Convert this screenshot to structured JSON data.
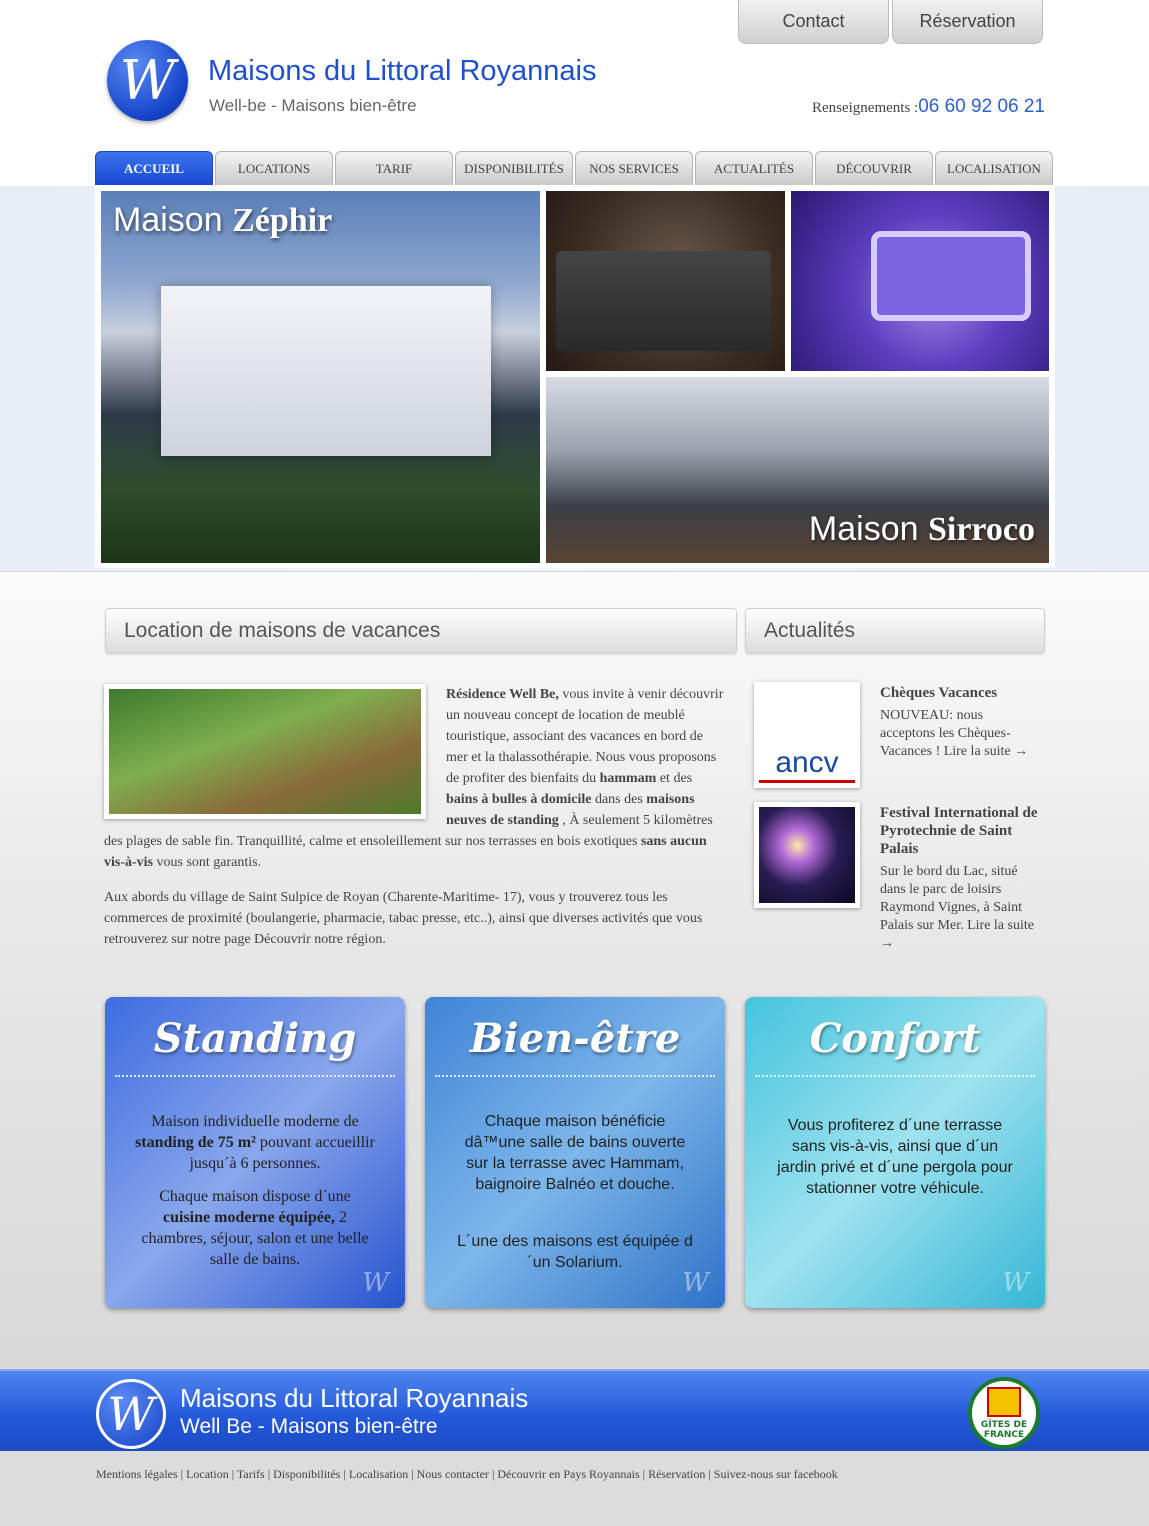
{
  "header": {
    "title": "Maisons du Littoral Royannais",
    "subtitle": "Well-be - Maisons bien-être",
    "logo_letter": "W",
    "contact_label": "Contact",
    "reservation_label": "Réservation",
    "phone_label": "Renseignements :",
    "phone": "06 60 92 06 21"
  },
  "nav": [
    "ACCUEIL",
    "LOCATIONS",
    "TARIF",
    "DISPONIBILITÉS",
    "NOS SERVICES",
    "ACTUALITÉS",
    "DÉCOUVRIR",
    "LOCALISATION"
  ],
  "gallery": {
    "cap1_a": "Maison ",
    "cap1_b": "Zéphir",
    "cap2_a": "Maison ",
    "cap2_b": "Sirroco"
  },
  "main": {
    "heading": "Location de maisons de vacances",
    "p1": [
      {
        "t": "Résidence Well Be,",
        "b": true
      },
      {
        "t": " vous invite à venir découvrir un nouveau concept de location de meublé touristique, associant des vacances en bord de mer et la thalassothérapie. Nous vous proposons de profiter des bienfaits du "
      },
      {
        "t": "hammam",
        "b": true
      },
      {
        "t": " et des "
      },
      {
        "t": "bains à bulles à domicile",
        "b": true
      },
      {
        "t": " dans des "
      },
      {
        "t": "maisons neuves de standing",
        "b": true
      },
      {
        "t": " , À seulement 5 kilomètres des plages de sable fin. Tranquillité, calme et ensoleillement sur nos terrasses en bois exotiques "
      },
      {
        "t": "sans aucun vis-à-vis",
        "b": true
      },
      {
        "t": " vous sont garantis."
      }
    ],
    "p2": "Aux abords du village de Saint Sulpice de Royan (Charente-Maritime- 17), vous y trouverez tous les commerces de proximité (boulangerie, pharmacie, tabac presse, etc..), ainsi que diverses activités que vous retrouverez sur notre page Découvrir notre région."
  },
  "news": {
    "heading": "Actualités",
    "items": [
      {
        "title": "Chèques Vacances",
        "text": "NOUVEAU: nous acceptons les Chèques-Vacances ! Lire la suite →",
        "logo": "ancv"
      },
      {
        "title": "Festival International de Pyrotechnie de Saint Palais",
        "text": "Sur le bord du Lac, situé dans le parc de loisirs Raymond Vignes, à Saint Palais sur Mer. Lire la suite →"
      }
    ]
  },
  "features": [
    {
      "title": "Standing",
      "paras": [
        [
          {
            "t": "Maison individuelle moderne de "
          },
          {
            "t": "standing de 75 m²",
            "b": true
          },
          {
            "t": " pouvant accueillir jusqu´à 6 personnes."
          }
        ],
        [
          {
            "t": "Chaque maison dispose d´une "
          },
          {
            "t": "cuisine moderne équipée,",
            "b": true
          },
          {
            "t": " 2 chambres, séjour, salon et une belle salle de bains."
          }
        ]
      ]
    },
    {
      "title": "Bien-être",
      "paras": [
        [
          {
            "t": "Chaque maison bénéficie dâ™une salle de bains ouverte sur la terrasse avec "
          },
          {
            "t": "Hammam",
            "h": true
          },
          {
            "t": ", baignoire "
          },
          {
            "t": "Balnéo",
            "h": true
          },
          {
            "t": " et douche."
          }
        ],
        [
          {
            "t": "L´une des maisons est équipée d´un "
          },
          {
            "t": "Solarium",
            "h": true
          },
          {
            "t": "."
          }
        ]
      ]
    },
    {
      "title": "Confort",
      "paras": [
        [
          {
            "t": "Vous profiterez d´une "
          },
          {
            "t": "terrasse sans vis-à-vis",
            "h": true
          },
          {
            "t": ", ainsi que d´un "
          },
          {
            "t": "jardin privé",
            "h": true
          },
          {
            "t": " et d´une "
          },
          {
            "t": "pergola",
            "h": true
          },
          {
            "t": " pour stationner votre véhicule."
          }
        ]
      ]
    }
  ],
  "footer": {
    "title": "Maisons du Littoral Royannais",
    "subtitle": "Well Be - Maisons bien-être",
    "badge": "GÎTES DE FRANCE",
    "links": [
      "Mentions légales",
      "Location",
      "Tarifs",
      "Disponibilités",
      "Localisation",
      "Nous contacter",
      "Découvrir en Pays Royannais",
      "Réservation",
      "Suivez-nous sur facebook"
    ]
  }
}
